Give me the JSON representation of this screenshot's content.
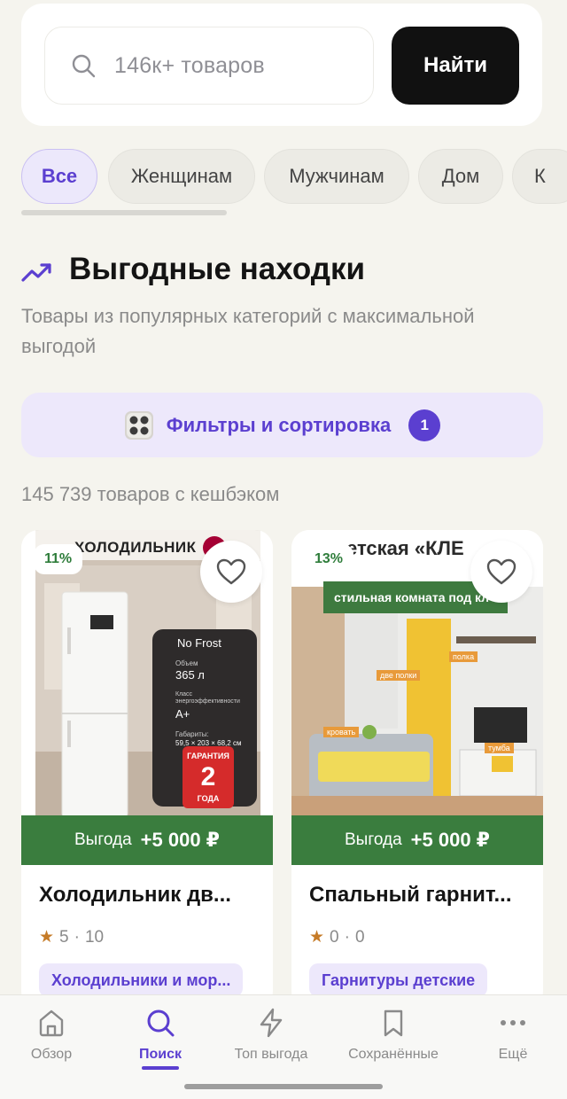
{
  "search": {
    "placeholder": "146к+ товаров",
    "button_label": "Найти"
  },
  "categories": [
    {
      "label": "Все",
      "active": true
    },
    {
      "label": "Женщинам",
      "active": false
    },
    {
      "label": "Мужчинам",
      "active": false
    },
    {
      "label": "Дом",
      "active": false
    },
    {
      "label": "К",
      "active": false
    }
  ],
  "section": {
    "title": "Выгодные находки",
    "subtitle": "Товары из популярных категорий с максимальной выгодой",
    "icon": "trending-up-icon"
  },
  "filters": {
    "label": "Фильтры и сортировка",
    "badge": "1"
  },
  "results_count": "145 739 товаров с кешбэком",
  "products": [
    {
      "name": "Холодильник дв...",
      "cashback": "11%",
      "benefit_label": "Выгода",
      "benefit_value": "+5 000 ₽",
      "rating": "5",
      "reviews": "10",
      "category": "Холодильники и мор...",
      "image_texts": {
        "header": "ХОЛОДИЛЬНИК",
        "feature": "No Frost",
        "volume_label": "Объем",
        "volume": "365 л",
        "energy_label": "Класс энергоэффективности",
        "energy": "A+",
        "dims_label": "Габариты:",
        "dims": "59,5 × 203 × 68,2 см",
        "warranty_label": "ГАРАНТИЯ",
        "warranty_years": "2",
        "warranty_unit": "ГОДА"
      }
    },
    {
      "name": "Спальный гарнит...",
      "cashback": "13%",
      "benefit_label": "Выгода",
      "benefit_value": "+5 000 ₽",
      "rating": "0",
      "reviews": "0",
      "category": "Гарнитуры детские",
      "image_texts": {
        "header": "етская «КЛЕ",
        "banner": "стильная комната под кл",
        "tag1": "полка",
        "tag2": "две полки",
        "tag3": "кровать",
        "tag4": "тумба"
      }
    }
  ],
  "tabbar": [
    {
      "label": "Обзор",
      "icon": "home-icon",
      "active": false
    },
    {
      "label": "Поиск",
      "icon": "search-icon",
      "active": true
    },
    {
      "label": "Топ выгода",
      "icon": "lightning-icon",
      "active": false
    },
    {
      "label": "Сохранённые",
      "icon": "bookmark-icon",
      "active": false
    },
    {
      "label": "Ещё",
      "icon": "more-dots-icon",
      "active": false
    }
  ],
  "colors": {
    "accent": "#5b3fd0",
    "benefit_green": "#3a7d3e",
    "background": "#f5f4ee"
  }
}
